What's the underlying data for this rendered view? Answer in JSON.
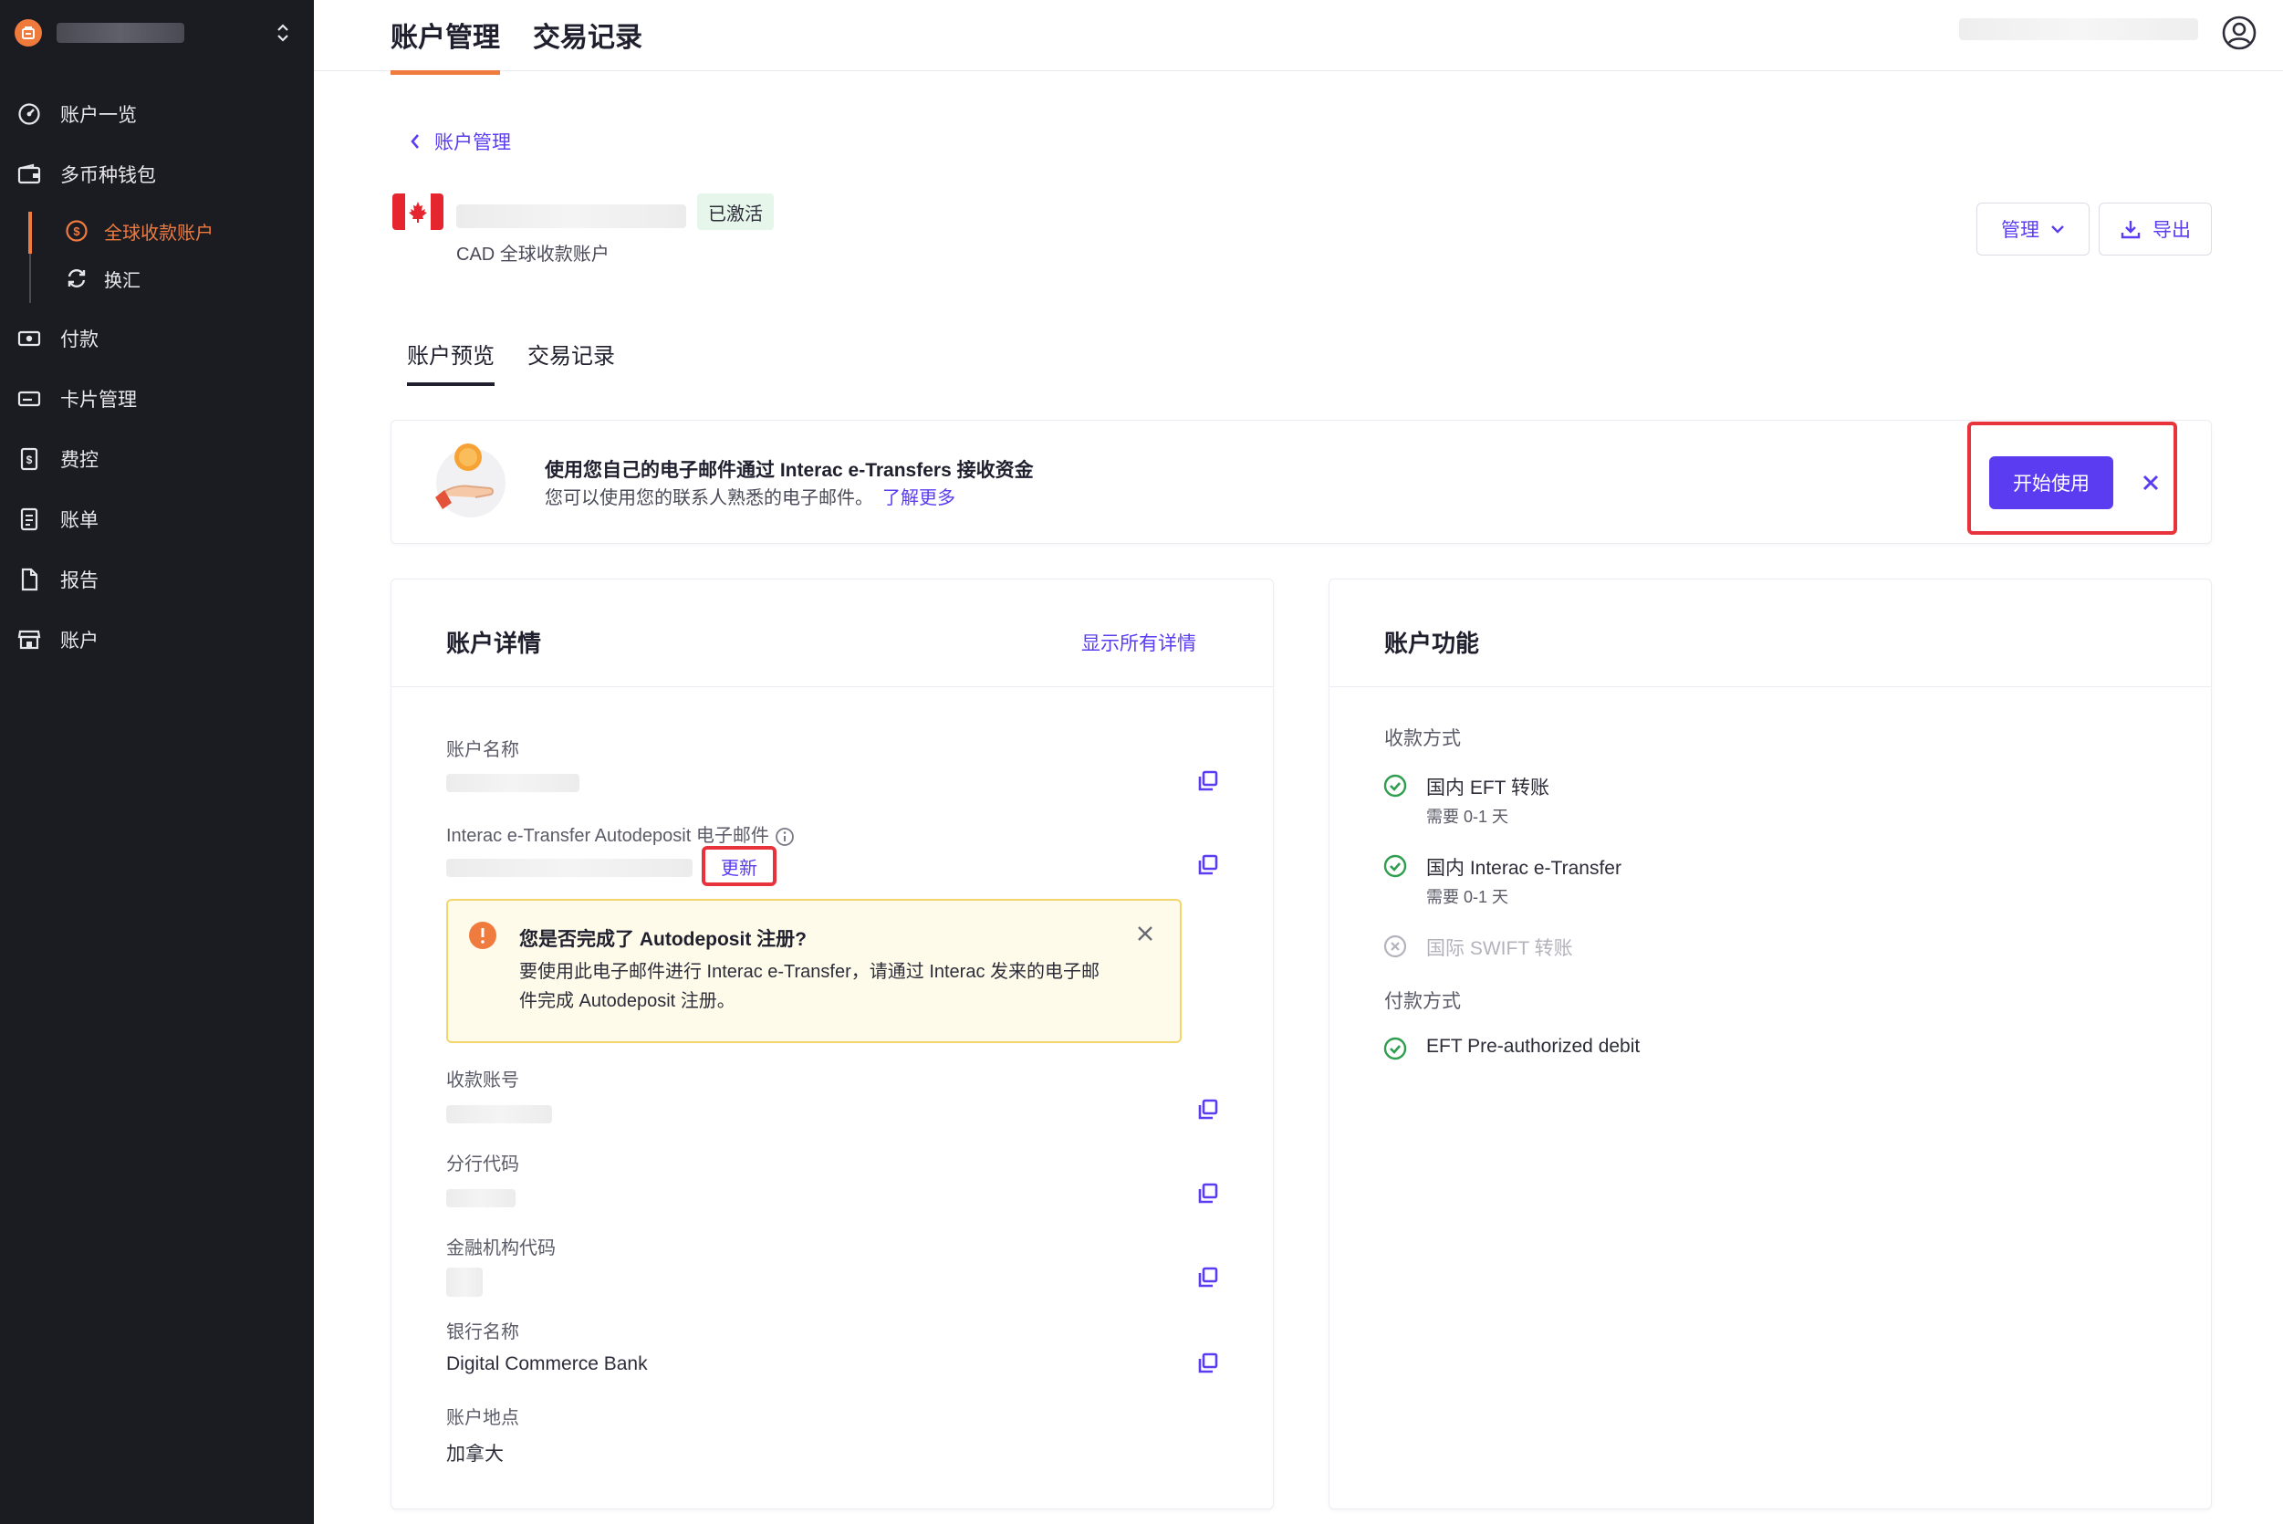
{
  "sidebar": {
    "items": [
      {
        "label": "账户一览",
        "icon": "dashboard-icon"
      },
      {
        "label": "多币种钱包",
        "icon": "wallet-icon"
      },
      {
        "label": "全球收款账户",
        "icon": "dollar-coin-icon"
      },
      {
        "label": "换汇",
        "icon": "exchange-icon"
      },
      {
        "label": "付款",
        "icon": "payment-icon"
      },
      {
        "label": "卡片管理",
        "icon": "card-icon"
      },
      {
        "label": "费控",
        "icon": "expense-icon"
      },
      {
        "label": "账单",
        "icon": "bill-icon"
      },
      {
        "label": "报告",
        "icon": "report-icon"
      },
      {
        "label": "账户",
        "icon": "store-icon"
      }
    ],
    "active_item": "全球收款账户",
    "accent_color": "#f07b3f"
  },
  "topbar": {
    "tabs": [
      "账户管理",
      "交易记录"
    ],
    "active_tab": "账户管理"
  },
  "page": {
    "back_label": "账户管理",
    "account_status": "已激活",
    "account_subtitle": "CAD 全球收款账户",
    "manage_label": "管理",
    "export_label": "导出",
    "subtabs": [
      "账户预览",
      "交易记录"
    ],
    "active_subtab": "账户预览"
  },
  "banner": {
    "title": "使用您自己的电子邮件通过 Interac e-Transfers 接收资金",
    "description": "您可以使用您的联系人熟悉的电子邮件。",
    "learn_more": "了解更多",
    "cta_label": "开始使用"
  },
  "details": {
    "title": "账户详情",
    "show_all": "显示所有详情",
    "fields": {
      "account_name": "账户名称",
      "autodeposit_email": "Interac e-Transfer Autodeposit 电子邮件",
      "update_label": "更新",
      "account_number": "收款账号",
      "branch_code": "分行代码",
      "institution_code": "金融机构代码",
      "bank_name": "银行名称",
      "bank_name_value": "Digital Commerce Bank",
      "location": "账户地点",
      "location_value": "加拿大"
    },
    "warning": {
      "title": "您是否完成了 Autodeposit 注册?",
      "body": "要使用此电子邮件进行 Interac e-Transfer，请通过 Interac 发来的电子邮件完成 Autodeposit 注册。"
    }
  },
  "features": {
    "title": "账户功能",
    "receive_label": "收款方式",
    "receive_methods": [
      {
        "name": "国内 EFT 转账",
        "note": "需要 0-1 天",
        "enabled": true
      },
      {
        "name": "国内 Interac e-Transfer",
        "note": "需要 0-1 天",
        "enabled": true
      },
      {
        "name": "国际 SWIFT 转账",
        "note": "",
        "enabled": false
      }
    ],
    "pay_label": "付款方式",
    "pay_methods": [
      {
        "name": "EFT Pre-authorized debit",
        "enabled": true
      }
    ]
  },
  "colors": {
    "primary": "#5b3cf0",
    "success": "#2e9d4e",
    "highlight": "#e8333c",
    "warning_border": "#f3d56b"
  }
}
